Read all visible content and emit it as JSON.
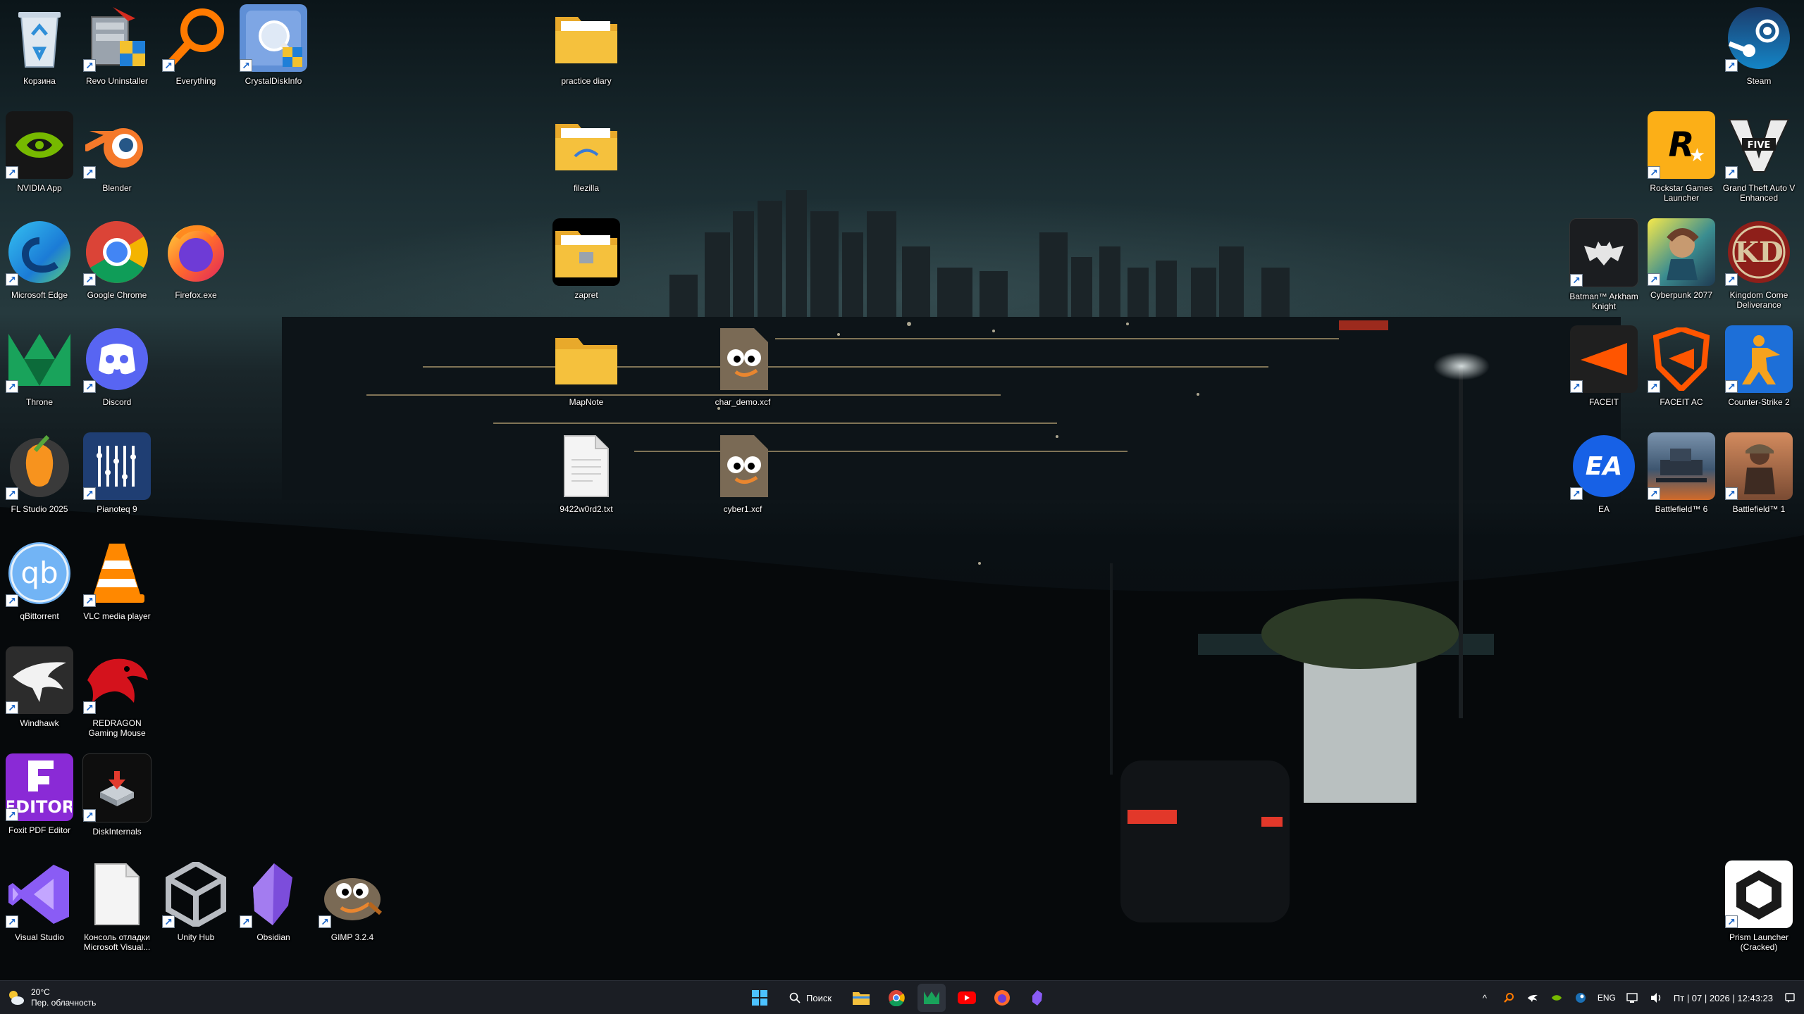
{
  "desktop": {
    "icons": {
      "recycle_bin": "Корзина",
      "revo": "Revo Uninstaller",
      "everything": "Everything",
      "crystaldisk": "CrystalDiskInfo",
      "practice_diary": "practice diary",
      "steam": "Steam",
      "nvidia": "NVIDIA App",
      "blender": "Blender",
      "filezilla": "filezilla",
      "rockstar": "Rockstar Games Launcher",
      "gta": "Grand Theft Auto V Enhanced",
      "edge": "Microsoft Edge",
      "chrome": "Google Chrome",
      "firefox": "Firefox.exe",
      "zapret": "zapret",
      "batman": "Batman™ Arkham Knight",
      "cyberpunk": "Cyberpunk 2077",
      "kcd": "Kingdom Come Deliverance",
      "throne": "Throne",
      "discord": "Discord",
      "mapnote": "MapNote",
      "char_demo": "char_demo.xcf",
      "faceit": "FACEIT",
      "faceit_ac": "FACEIT AC",
      "cs2": "Counter-Strike 2",
      "fl": "FL Studio 2025",
      "pianoteq": "Pianoteq 9",
      "txtfile": "9422w0rd2.txt",
      "cyber1": "cyber1.xcf",
      "ea": "EA",
      "bf6": "Battlefield™ 6",
      "bf1": "Battlefield™ 1",
      "qbit": "qBittorrent",
      "vlc": "VLC media player",
      "windhawk": "Windhawk",
      "redragon": "REDRAGON Gaming Mouse",
      "foxit": "Foxit PDF Editor",
      "diskinternals": "DiskInternals",
      "vs": "Visual Studio",
      "vs_console": "Консоль отладки Microsoft Visual...",
      "unity": "Unity Hub",
      "obsidian": "Obsidian",
      "gimp": "GIMP 3.2.4",
      "prism": "Prism Launcher (Cracked)"
    }
  },
  "taskbar": {
    "weather": {
      "temp": "20°C",
      "condition": "Пер. облачность"
    },
    "search_label": "Поиск",
    "language": "ENG",
    "datetime": "Пт | 07 | 2026 | 12:43:23"
  },
  "colors": {
    "taskbar_bg": "#1b1e24",
    "folder": "#f5c13d",
    "accent": "#0078d4"
  }
}
